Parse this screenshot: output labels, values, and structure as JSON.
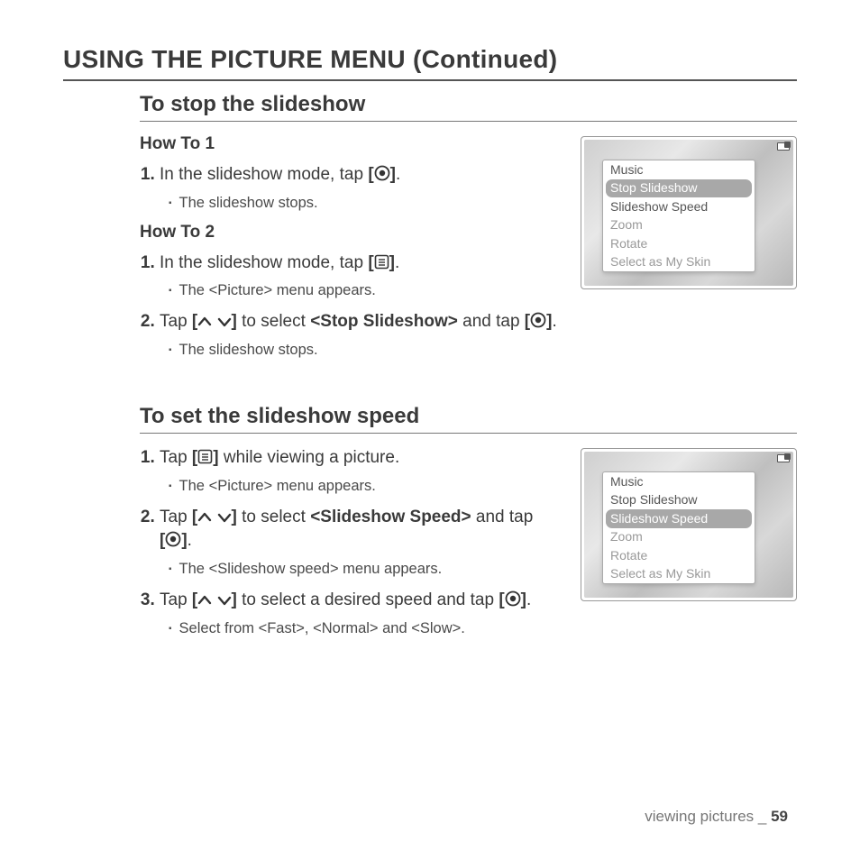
{
  "title": "USING THE PICTURE MENU (Continued)",
  "section1": {
    "heading": "To stop the slideshow",
    "howto1_label": "How To 1",
    "howto1_step1_a": "In the slideshow mode, tap ",
    "howto1_step1_b": ".",
    "howto1_bullet": "The slideshow stops.",
    "howto2_label": "How To 2",
    "howto2_step1_a": "In the slideshow mode, tap ",
    "howto2_step1_b": ".",
    "howto2_bullet1": "The <Picture> menu appears.",
    "howto2_step2_a": "Tap ",
    "howto2_step2_b": " to select ",
    "howto2_step2_bold": "<Stop Slideshow>",
    "howto2_step2_c": " and tap ",
    "howto2_step2_d": ".",
    "howto2_bullet2": "The slideshow stops."
  },
  "section2": {
    "heading": "To set the slideshow speed",
    "step1_a": "Tap ",
    "step1_b": " while viewing a picture.",
    "bullet1": "The <Picture> menu appears.",
    "step2_a": "Tap ",
    "step2_b": " to select ",
    "step2_bold": "<Slideshow Speed>",
    "step2_c": " and tap ",
    "step2_d": ".",
    "bullet2": "The <Slideshow speed> menu appears.",
    "step3_a": "Tap ",
    "step3_b": " to select a desired speed and tap ",
    "step3_c": ".",
    "bullet3": "Select from <Fast>, <Normal> and <Slow>."
  },
  "menu_items": [
    "Music",
    "Stop Slideshow",
    "Slideshow Speed",
    "Zoom",
    "Rotate",
    "Select as My Skin"
  ],
  "screenshot1_selected_index": 1,
  "screenshot2_selected_index": 2,
  "footer": {
    "section": "viewing pictures",
    "sep": " _ ",
    "page": "59"
  }
}
